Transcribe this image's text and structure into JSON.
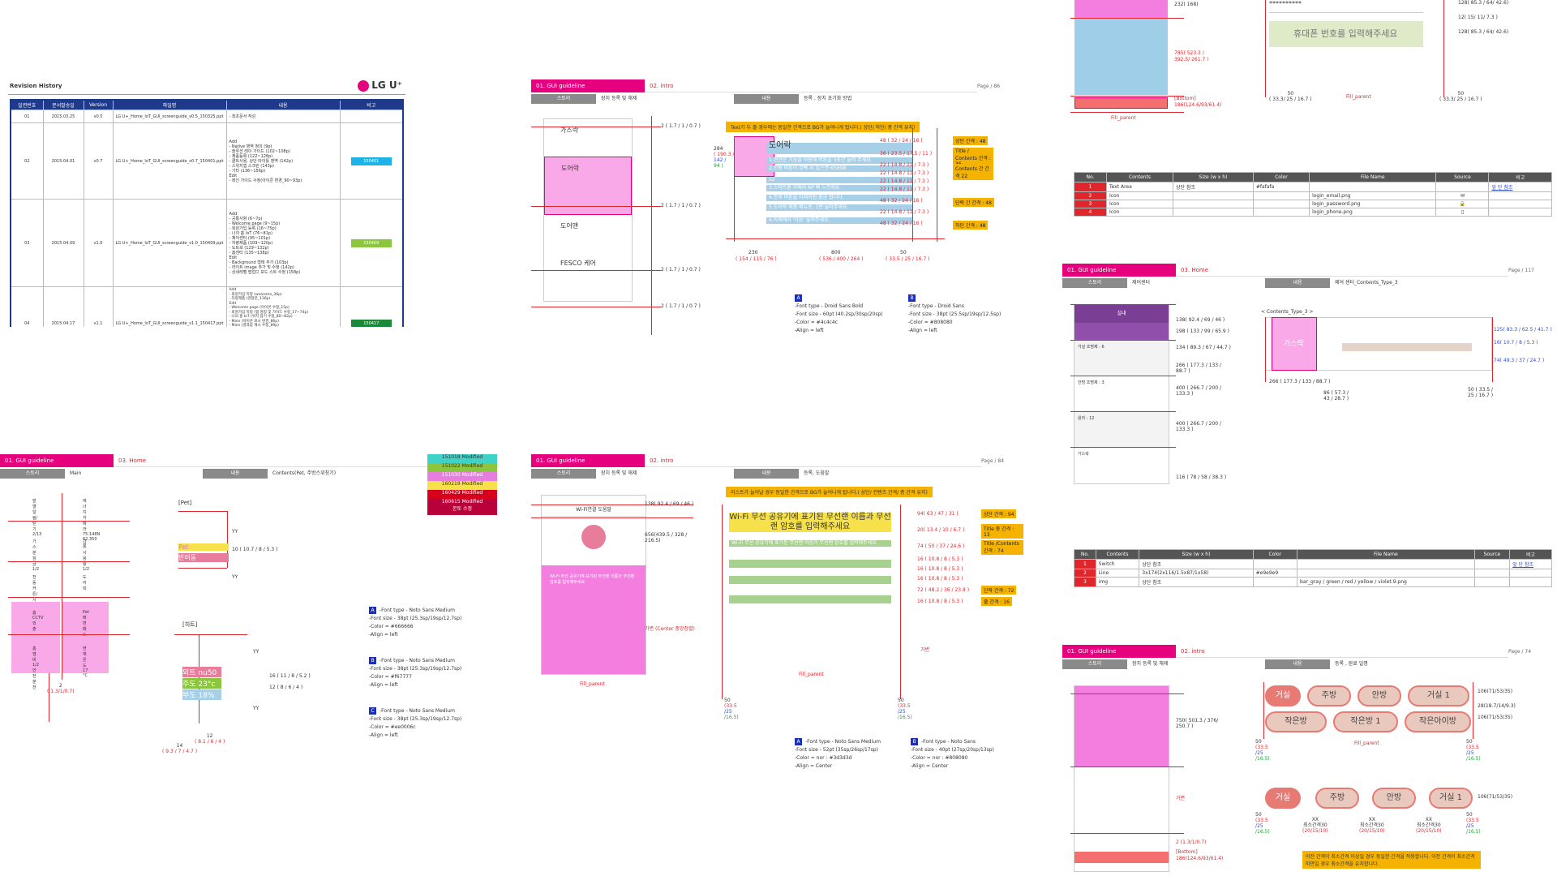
{
  "revision": {
    "title": "Revision History",
    "logo": "LG U⁺",
    "headers": [
      "일련번호",
      "문서발송일",
      "Version",
      "파일명",
      "내용",
      "비고"
    ],
    "rows": [
      {
        "no": "01",
        "date": "2015.03.25",
        "ver": "v0.5",
        "file": "LG U+_Home_IoT_GUI_screenguide_v0.5_150325.ppt",
        "content": "- 최초문서 작성",
        "note": ""
      },
      {
        "no": "02",
        "date": "2015.04.01",
        "ver": "v0.7",
        "file": "LG U+_Home_IoT_GUI_screenguide_v0.7_150401.ppt",
        "content": "Add\n- Native 영역 정의 (9p)\n- 솔루션 레이 가이드 (102~108p)\n- 제품등록 (122~128p)\n- 클트사용, 상단 타이틀 영역 (142p)\n- 스위치앱 스크린 (143p)\n- 기타 (136~156p)\nEdit\n- 레인 가이드 수정(아이콘 변경_90~93p)",
        "note": "150401"
      },
      {
        "no": "03",
        "date": "2015.04.09",
        "ver": "v1.0",
        "file": "LG U+_Home_IoT_GUI_screenguide_v1.0_150409.ppt",
        "content": "Add\n- 공통사항 (6~7p)\n- Welcome page (9~15p)\n- 회원가입 등록 (16~75p)\n- 나의 홈 IoT (76~81p)\n- 제어센터 (95~101p)\n- 차량제품 (109~120p)\n- 도트보 (129~132p)\n- 홈센터 (135~138p)\nEdit\n- Background 형태 추가 (103p)\n- 라이트 image 추가 및 수정 (142p)\n- 상세레벨 팝업디 모드 스트 수정 (158p)",
        "note": "150409"
      },
      {
        "no": "04",
        "date": "2015.04.17",
        "ver": "v1.1",
        "file": "LG U+_Home_IoT_GUI_screenguide_v1.1_150417.ppt",
        "content": "Add\n- 회원가입 지정 (welcome_36p)\n- 차량제품 (경찰분_116p)\nEdit\n- Welcome page (아이콘 수정_15p)\n- 회원가입 지정 (앱 명칭 및 가이드 수정_17~74p)\n- 나의 홈 IoT (위치 잡기 수정_80~82p)\n- Main (아이콘 표시 변경_86p)\n- Main (결과값 제시 수정_89p)\n- 제어센터 (v1.4 ui구조에 따라 변경_96,97,99p)\n- 솔루션 메뉴 (v1.4 ui구조에 따라 변경_102~106p)\n- 차량제품 (변경 및 가이드 수정_116p)\n- 부가정보 (pwd수정_119~121p)\n- 기기카테고리 (pwd수정_135p)\n- 가이드 내 이미지 수정 (143,145p)\n- 상세 레인 (pwd수정_146~149p)",
        "note": "150417"
      }
    ]
  },
  "intro1": {
    "tag": "01. GUI guideline",
    "sub": "02. intro",
    "page": "Page /",
    "pageno": "86",
    "k1": "스토리",
    "v1": "장치 등록 및 해제",
    "k2": "내용",
    "v2": "등록 , 장치 초기화 방법",
    "items": [
      "가스락",
      "도어락",
      "도어맨",
      "FESCO 케어"
    ],
    "banner": "Text가 두 줄 경우에는 동일한 간격으로 BG가 늘어나게 됩니다.( 상단/ 하단/ 중 간격 유지)",
    "hl_title": "도어락",
    "lines": [
      "1.현관문 기능을 이용해 버튼을 3초간 눌러 주세요.",
      "2.전원 버튼이 깜빡 지 않으면 KS608",
      "S2",
      "3.스마트홈 카메라 AP 삐 누르세요.",
      "4.등록 버튼을 아래처럼 잠금 됩니다.",
      "5.도어락 제품 메뉴로, 1번 눌러주세요.",
      "6.아래에서 '다음' 눌러주세요."
    ],
    "specs": [
      "48 ( 32 / 24 / 16 )",
      "36 ( 23.5 / 17.5 / 11 )",
      "22 ( 14.8 / 11 / 7.3 )",
      "22 ( 14.8 / 11 / 7.3 )",
      "22 ( 14.8 / 11 / 7.3 )",
      "22 ( 14.8 / 11 / 7.3 )",
      "48 ( 32 / 24 / 16 )",
      "22 ( 14.8 / 11 / 7.3 )",
      "48 ( 32 / 24 / 16 )"
    ],
    "tags": [
      "상단 간격 : 48",
      "Title / Contents 간격 : 36",
      "Contents 간 간격 22",
      "단락 간 간격 : 48",
      "하단 간격 : 48"
    ],
    "side": [
      "284",
      "( 190.3 /",
      "142 /",
      "94 )"
    ],
    "left": "2 ( 1.7 / 1 / 0.7 )",
    "bottom": [
      "230",
      "( 154 / 115 / 76 )",
      "800",
      "( 536 / 400 / 264 )",
      "50",
      "( 33.5 / 25 / 16.7 )"
    ],
    "notesA": [
      "-Font type - Droid Sans Bold",
      "-Font size - 60pt (40.2sp/30sp/20sp)",
      "-Color = #4c4c4c",
      "-Align = left"
    ],
    "notesB": [
      "-Font type - Droid Sans",
      "-Font size - 38pt (25.5sp/19sp/12.5sp)",
      "-Color = #808080",
      "-Align = left"
    ]
  },
  "main": {
    "tag": "01. GUI guideline",
    "sub": "03. Home",
    "k1": "스토리",
    "v1": "Main",
    "k2": "내용",
    "v2": "Contents(Pet, 주방스위칭기)",
    "mods": [
      "151018 Modified",
      "151022 Modified",
      "151030 Modified",
      "160219 Modified",
      "160429 Modified",
      "160615 Modified\n본토 수정"
    ],
    "tiles": [
      "발열알림/닫기 2/13",
      "에너지카메라 75.148N 62,350원",
      "가스분 잠금 1/2",
      "가스사용량 1/2",
      "전동커튼/시리즈 1/2",
      "도어락",
      "홈CCTV 외출",
      "Pet 배변패드",
      "홈엠비 1/2 안전분전",
      "현재 온도 17 °C"
    ],
    "pet": "[Pet]",
    "pet_words": [
      "Pet",
      "반려동"
    ],
    "yy": "YY",
    "spec1": "10 ( 10.7 / 8 / 5.3 )",
    "heat": "[히트]",
    "heat_rows": [
      "외트 nu50",
      "주도 23°c",
      "부도 18%"
    ],
    "spec2": "16 ( 11 / 8 / 5.2 )",
    "spec3": "12 ( 8 / 6 / 4 )",
    "b1": "2",
    "b1s": "( 1.3/1/0.7)",
    "b2": "12",
    "b2s": "( 8.1 / 6 / 4 )",
    "b3": "14",
    "b3s": "( 9.3 / 7 / 4.7 )",
    "notes": [
      [
        "-Font type - Noto Sans Medium",
        "-Font size - 38pt (25.3sp/19sp/12.7sp)",
        "-Color = #666666",
        "-Align = left"
      ],
      [
        "-Font type - Noto Sans Medium",
        "-Font size - 38pt (25.3sp/19sp/12.7sp)",
        "-Color = #f67777",
        "-Align = left"
      ],
      [
        "-Font type - Noto Sans Medium",
        "-Font size - 38pt (25.3sp/19sp/12.7sp)",
        "-Color = #ee0006c",
        "-Align = left"
      ]
    ]
  },
  "intro2": {
    "tag": "01. GUI guideline",
    "sub": "02. intro",
    "page": "Page /",
    "pageno": "84",
    "k1": "스토리",
    "v1": "장치 등록 및 해제",
    "k2": "내용",
    "v2": "등록, 도움말",
    "dialog": "Wi-Fi연결 도움말",
    "dlg_text": "Wi-Fi 무선 공유기에 표기된 무선랜 이름과 무선랜 암호를 입력해주세요.",
    "banner": "리스트가 늘어날 경우 동일한 간격으로 BG가 늘어나게 됩니다.( 상단/ 컨텐츠 간격/ 중 간격 유지)",
    "title": "Wi-Fi 무선 공유기에 표기된 무선랜 이름과 무선랜 암호를 입력해주세요",
    "specs": [
      "94( 63 / 47 / 31 )",
      "20( 13.4 / 10 / 6.7 )",
      "74 ( 50 / 37 / 24.6 )",
      "16 ( 10.8 / 8 / 5.3 )",
      "16 ( 10.8 / 8 / 5.3 )",
      "16 ( 10.8 / 8 / 5.3 )",
      "72 ( 48.2 / 36 / 23.8 )",
      "16 ( 10.8 / 8 / 5.3 )"
    ],
    "tags": [
      "상단 간격 : 94",
      "Title 중 간격 : 13",
      "Title /Contents 간격 : 74",
      "단락 간격 : 72",
      "줄 간격 : 16"
    ],
    "size1": "138( 92.4 / 69 / 46 )",
    "size2": "656(439.5 / 328 / 216.5)",
    "center": "가변 (Center 중앙정렬)",
    "fill": "Fill_parent",
    "var": "가변",
    "b": [
      "50",
      "(33.5",
      "/25",
      "/16.5)"
    ],
    "notesA": [
      "-Font type - Noto Sans Medium",
      "-Font size - 52pt (35sp/26sp/17sp)",
      "-Color = nor : #3d3d3d",
      "foc : #f53b88",
      "-Align = Center"
    ],
    "notesB": [
      "-Font type - Noto Sans",
      "-Font size - 40pt (27sp/20sp/13sp)",
      "-Color = nor : #808080",
      "foc : #f67777",
      "-Align = Center"
    ]
  },
  "tr1": {
    "specs": [
      "232( 168)",
      "785( 523.3 / 392.5/ 261.7 )",
      "186(124.6/93/61.4)"
    ],
    "bottom": "[Bottom]",
    "fill": "Fill_parent",
    "phone": "휴대폰 번호를 입력해주세요",
    "stars": "**********",
    "rspec": [
      "128( 85.3 / 64/ 42.6)",
      "12( 15/ 11/ 7.3 )",
      "128( 85.3 / 64/ 42.6)"
    ],
    "b": "50",
    "bs": "( 33.3/ 25 / 16.7 )",
    "th": [
      "No.",
      "Contents",
      "Size (w x h)",
      "Color",
      "File Name",
      "Source",
      "비고"
    ],
    "rows": [
      [
        "1",
        "Text Area",
        "상단 참조",
        "#fafafa",
        "",
        "",
        "앞 단 참조"
      ],
      [
        "2",
        "Icon",
        "",
        "",
        "login_email.png",
        "✉",
        ""
      ],
      [
        "3",
        "Icon",
        "",
        "",
        "login_password.png",
        "🔒",
        ""
      ],
      [
        "4",
        "Icon",
        "",
        "",
        "login_phone.png",
        "▯",
        ""
      ]
    ]
  },
  "ctrl": {
    "tag": "01. GUI guideline",
    "sub": "03. Home",
    "page": "Page /",
    "pageno": "117",
    "k1": "스토리",
    "v1": "제어센터",
    "k2": "내용",
    "v2": "제어 센터_Contents_Type_3",
    "title": "실내",
    "specs": [
      "138( 92.4 / 69 / 46 )",
      "198 ( 133 / 99 / 65.9 )",
      "134 ( 89.3 / 67 / 44.7 )",
      "266 ( 177.3 / 133 / 88.7 )",
      "400 ( 266.7 / 200 / 133.3 )",
      "400 ( 266.7 / 200 / 133.3 )",
      "116 ( 78 / 58 / 38.3 )"
    ],
    "rooms": [
      "거실 조명제 : 6",
      "안방 조명제 : 3",
      "원리 : 12",
      "가스락"
    ],
    "type": "< Contents_Type_3 >",
    "gas": "가스락",
    "rs": [
      "125( 83.3 / 62.5 / 41.7 )",
      "16( 10.7 / 8 / 5.3 )",
      "74( 49.3 / 37 / 24.7 )"
    ],
    "bs": [
      "266 ( 177.3 / 133 / 88.7 )",
      "86 ( 57.3 / 43 / 28.7 )",
      "50 ( 33.5 / 25 / 16.7 )"
    ],
    "th": [
      "No.",
      "Contents",
      "Size (w x h)",
      "Color",
      "File Name",
      "Source",
      "비고"
    ],
    "rows": [
      [
        "1",
        "Switch",
        "상단 참조",
        "",
        "",
        "",
        "앞 단 참조"
      ],
      [
        "2",
        "Line",
        "3x174(2x116/1.5x87/1x58)",
        "#e9e9e9",
        "",
        "",
        ""
      ],
      [
        "3",
        "img",
        "상단 참조",
        "",
        "bar_gray / green / red / yellow / violet.9.png",
        "",
        ""
      ]
    ]
  },
  "intro3": {
    "tag": "01. GUI guideline",
    "sub": "02. intro",
    "page": "Page /",
    "pageno": "74",
    "k1": "스토리",
    "v1": "장치 등록 및 해제",
    "k2": "내용",
    "v2": "등록 , 완료 일명",
    "pills1": [
      "거실",
      "주방",
      "안방",
      "거실 1",
      "작은방",
      "작은방 1",
      "작은아이방"
    ],
    "pills2": [
      "거실",
      "주방",
      "안방",
      "거실 1"
    ],
    "rs1": [
      "106(71/53/35)",
      "28(18.7/14/9.3)",
      "106(71/53/35)"
    ],
    "rs2": "106(71/53/35)",
    "fill": "Fill_parent",
    "specs": [
      "750( 501.3 / 376/ 250.7 )",
      "186(124.6/93/61.4)",
      "2 (1.3/1/0.7)"
    ],
    "bottom": "[Bottom]",
    "var": "가변",
    "gap": [
      "XX",
      "최소간격30",
      "(20/15/10)"
    ],
    "b": [
      "50",
      "(33.5",
      "/25",
      "/16.5)"
    ],
    "note": "이전 간격이 최소간격 이상일 경우 동일한 간격을 적용합니다. 이전 간격이 최소간격 미만일 경우 최소간격을 유지합니다."
  }
}
